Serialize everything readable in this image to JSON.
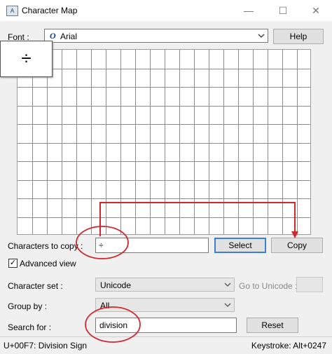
{
  "window": {
    "title": "Character Map",
    "icon_text": "A",
    "minimize_glyph": "—",
    "maximize_glyph": "☐",
    "close_glyph": "✕"
  },
  "font": {
    "label": "Font :",
    "value": "Arial",
    "font_glyph": "O",
    "help_label": "Help"
  },
  "grid": {
    "enlarged_char": "÷",
    "columns": 20,
    "rows": 10
  },
  "copy_row": {
    "label": "Characters to copy :",
    "value": "÷",
    "select_label": "Select",
    "copy_label": "Copy"
  },
  "advanced": {
    "label": "Advanced view",
    "checked": true,
    "check_glyph": "✓"
  },
  "character_set": {
    "label": "Character set :",
    "value": "Unicode",
    "goto_label": "Go to Unicode :",
    "goto_value": ""
  },
  "group_by": {
    "label": "Group by :",
    "value": "All"
  },
  "search": {
    "label": "Search for :",
    "value": "division",
    "reset_label": "Reset"
  },
  "status": {
    "char_info": "U+00F7: Division Sign",
    "keystroke": "Keystroke: Alt+0247"
  },
  "annotation_color": "#d0282e"
}
